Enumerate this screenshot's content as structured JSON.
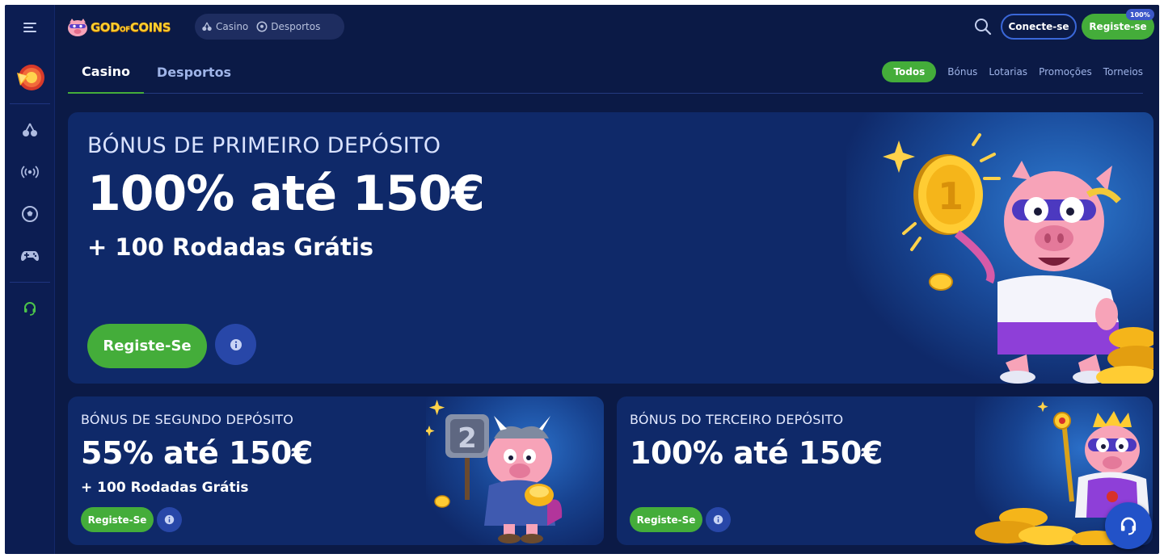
{
  "header": {
    "logo_main": "GOD",
    "logo_of": "OF",
    "logo_coins": "COINS",
    "switch": [
      {
        "label": "Casino",
        "icon": "cherry-icon"
      },
      {
        "label": "Desportos",
        "icon": "football-icon"
      }
    ],
    "login_label": "Conecte-se",
    "register_label": "Registe-se",
    "register_badge": "100%"
  },
  "sidebar": {
    "items": [
      {
        "icon": "menu-icon"
      },
      {
        "icon": "promo-wheel-icon"
      },
      {
        "icon": "cherry-icon"
      },
      {
        "icon": "live-broadcast-icon"
      },
      {
        "icon": "football-icon"
      },
      {
        "icon": "gamepad-icon"
      },
      {
        "icon": "headset-icon"
      }
    ]
  },
  "tabs": {
    "casino": "Casino",
    "sports": "Desportos"
  },
  "filters": [
    "Todos",
    "Bónus",
    "Lotarias",
    "Promoções",
    "Torneios"
  ],
  "hero": {
    "subtitle": "BÓNUS DE PRIMEIRO DEPÓSITO",
    "title": "100% até 150€",
    "extra": "+ 100 Rodadas Grátis",
    "register_label": "Registe-Se"
  },
  "cards": [
    {
      "subtitle": "BÓNUS DE SEGUNDO DEPÓSITO",
      "title": "55% até 150€",
      "extra": "+ 100 Rodadas Grátis",
      "register_label": "Registe-Se"
    },
    {
      "subtitle": "BÓNUS DO TERCEIRO DEPÓSITO",
      "title": "100% até 150€",
      "register_label": "Registe-Se"
    }
  ],
  "colors": {
    "background": "#0b1a46",
    "panel": "#0f2969",
    "accent_green": "#44ad3a",
    "accent_blue": "#3a67d8"
  }
}
